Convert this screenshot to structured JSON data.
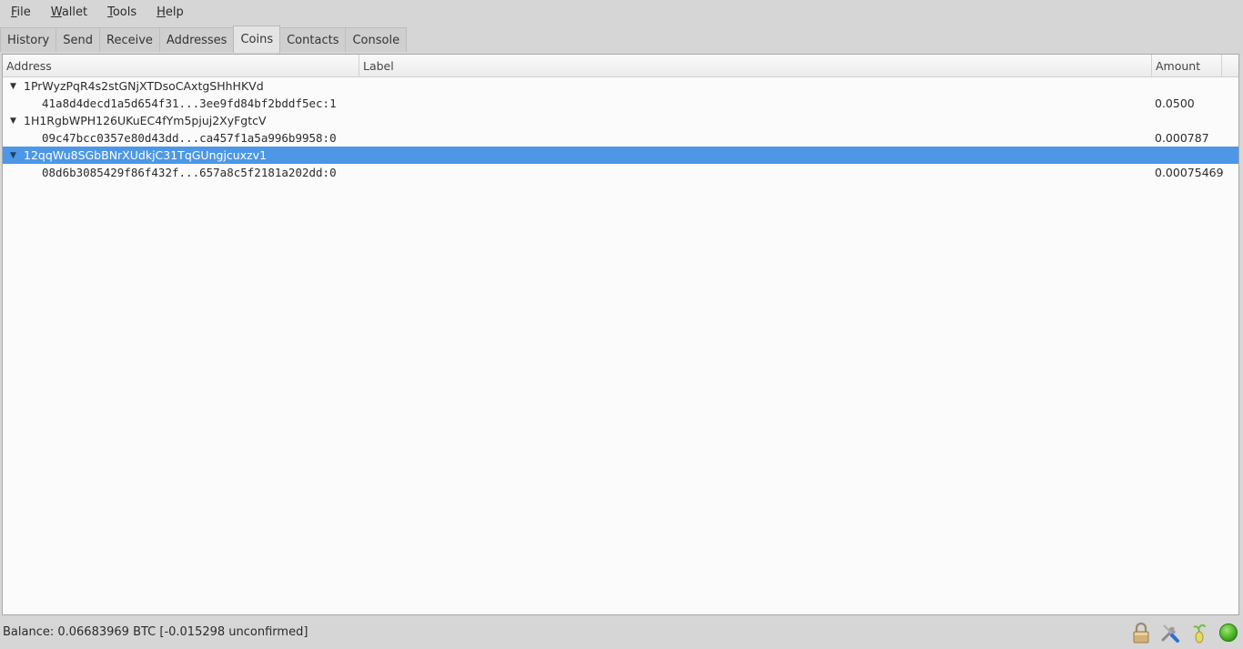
{
  "menu": [
    {
      "label": "File",
      "mnemonic": "F",
      "rest": "ile"
    },
    {
      "label": "Wallet",
      "mnemonic": "W",
      "rest": "allet"
    },
    {
      "label": "Tools",
      "mnemonic": "T",
      "rest": "ools"
    },
    {
      "label": "Help",
      "mnemonic": "H",
      "rest": "elp"
    }
  ],
  "tabs": [
    {
      "label": "History",
      "active": false
    },
    {
      "label": "Send",
      "active": false
    },
    {
      "label": "Receive",
      "active": false
    },
    {
      "label": "Addresses",
      "active": false
    },
    {
      "label": "Coins",
      "active": true
    },
    {
      "label": "Contacts",
      "active": false
    },
    {
      "label": "Console",
      "active": false
    }
  ],
  "table": {
    "columns": [
      "Address",
      "Label",
      "Amount"
    ],
    "groups": [
      {
        "address": "1PrWyzPqR4s2stGNjXTDsoCAxtgSHhHKVd",
        "label": "",
        "selected": false,
        "expanded": true,
        "coins": [
          {
            "outpoint": "41a8d4decd1a5d654f31...3ee9fd84bf2bddf5ec:1",
            "amount": "0.0500"
          }
        ]
      },
      {
        "address": "1H1RgbWPH126UKuEC4fYm5pjuj2XyFgtcV",
        "label": "",
        "selected": false,
        "expanded": true,
        "coins": [
          {
            "outpoint": "09c47bcc0357e80d43dd...ca457f1a5a996b9958:0",
            "amount": "0.000787"
          }
        ]
      },
      {
        "address": "12qqWu8SGbBNrXUdkjC31TqGUngjcuxzv1",
        "label": "",
        "selected": true,
        "expanded": true,
        "coins": [
          {
            "outpoint": "08d6b3085429f86f432f...657a8c5f2181a202dd:0",
            "amount": "0.00075469"
          }
        ]
      }
    ]
  },
  "status": {
    "balance_text": "Balance: 0.06683969 BTC  [-0.015298 unconfirmed]",
    "icons": [
      "lock-icon",
      "preferences-icon",
      "seed-icon",
      "network-status-icon"
    ],
    "network_color": "#3cb81a"
  }
}
